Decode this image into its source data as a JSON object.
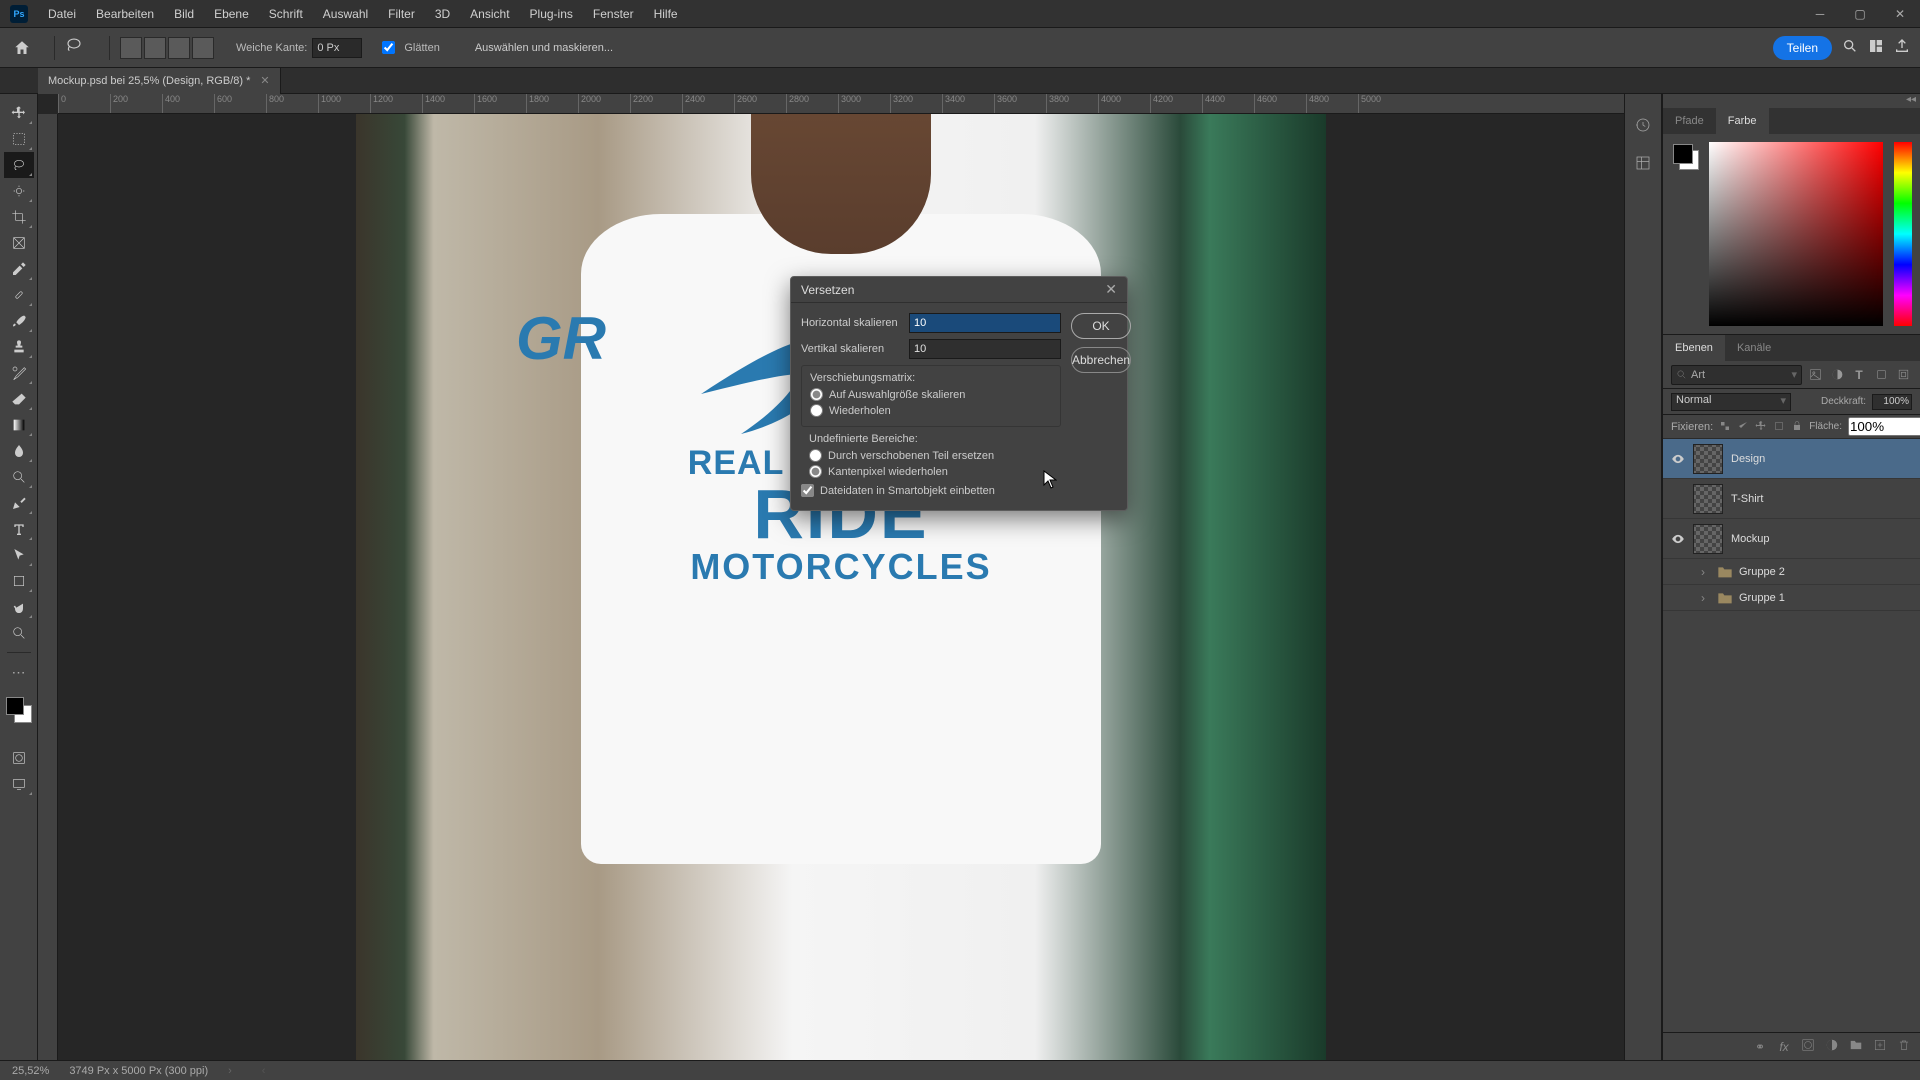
{
  "menubar": {
    "items": [
      "Datei",
      "Bearbeiten",
      "Bild",
      "Ebene",
      "Schrift",
      "Auswahl",
      "Filter",
      "3D",
      "Ansicht",
      "Plug-ins",
      "Fenster",
      "Hilfe"
    ]
  },
  "options": {
    "feather_label": "Weiche Kante:",
    "feather_value": "0 Px",
    "antialias_label": "Glätten",
    "select_mask_btn": "Auswählen und maskieren...",
    "share_btn": "Teilen"
  },
  "doc_tab": {
    "title": "Mockup.psd bei 25,5% (Design, RGB/8) *"
  },
  "ruler_ticks": [
    "0",
    "200",
    "400",
    "600",
    "800",
    "1000",
    "1200",
    "1400",
    "1600",
    "1800",
    "2000",
    "2200",
    "2400",
    "2600",
    "2800",
    "3000",
    "3200",
    "3400",
    "3600",
    "3800",
    "4000",
    "4200",
    "4400",
    "4600",
    "4800",
    "5000"
  ],
  "design": {
    "gr": "GR",
    "line1": "REAL GRANDPAS",
    "line2": "RIDE",
    "line3": "MOTORCYCLES"
  },
  "color_tabs": {
    "pfade": "Pfade",
    "farbe": "Farbe"
  },
  "layers": {
    "tab_ebenen": "Ebenen",
    "tab_kanale": "Kanäle",
    "search_label": "Art",
    "blend_mode": "Normal",
    "opacity_label": "Deckkraft:",
    "opacity_value": "100%",
    "lock_label": "Fixieren:",
    "fill_label": "Fläche:",
    "fill_value": "100%",
    "items": [
      {
        "name": "Design",
        "visible": true,
        "selected": true,
        "type": "layer"
      },
      {
        "name": "T-Shirt",
        "visible": false,
        "selected": false,
        "type": "layer"
      },
      {
        "name": "Mockup",
        "visible": true,
        "selected": false,
        "type": "layer"
      },
      {
        "name": "Gruppe 2",
        "visible": false,
        "selected": false,
        "type": "group"
      },
      {
        "name": "Gruppe 1",
        "visible": false,
        "selected": false,
        "type": "group"
      }
    ]
  },
  "dialog": {
    "title": "Versetzen",
    "h_label": "Horizontal skalieren",
    "h_value": "10",
    "v_label": "Vertikal skalieren",
    "v_value": "10",
    "matrix_title": "Verschiebungsmatrix:",
    "matrix_opt1": "Auf Auswahlgröße skalieren",
    "matrix_opt2": "Wiederholen",
    "undef_title": "Undefinierte Bereiche:",
    "undef_opt1": "Durch verschobenen Teil ersetzen",
    "undef_opt2": "Kantenpixel wiederholen",
    "embed_check": "Dateidaten in Smartobjekt einbetten",
    "ok": "OK",
    "cancel": "Abbrechen"
  },
  "status": {
    "zoom": "25,52%",
    "dims": "3749 Px x 5000 Px (300 ppi)"
  }
}
